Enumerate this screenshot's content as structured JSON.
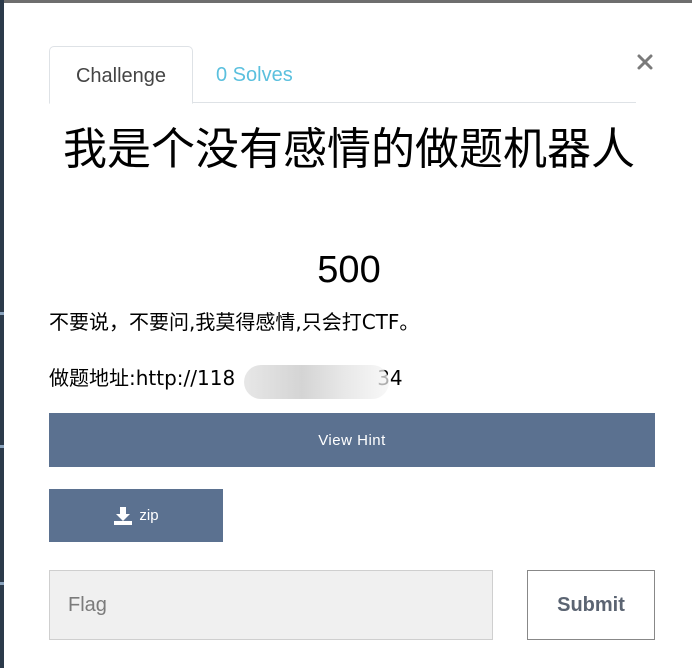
{
  "tabs": {
    "challenge_label": "Challenge",
    "solves_label": "0 Solves"
  },
  "close_icon": "close-icon",
  "challenge": {
    "name": "我是个没有感情的做题机器人",
    "value": "500",
    "description": "不要说，不要问,我莫得感情,只会打CTF。",
    "address_visible_start": "做题地址:http://118",
    "address_visible_end": "34"
  },
  "buttons": {
    "view_hint_label": "View Hint",
    "file_label": "zip",
    "file_icon": "download-icon",
    "submit_label": "Submit"
  },
  "flag_input": {
    "placeholder": "Flag",
    "value": ""
  },
  "colors": {
    "button_bg": "#5b7190",
    "solves_tab": "#5bc0de",
    "input_bg": "#f0f0f0"
  }
}
